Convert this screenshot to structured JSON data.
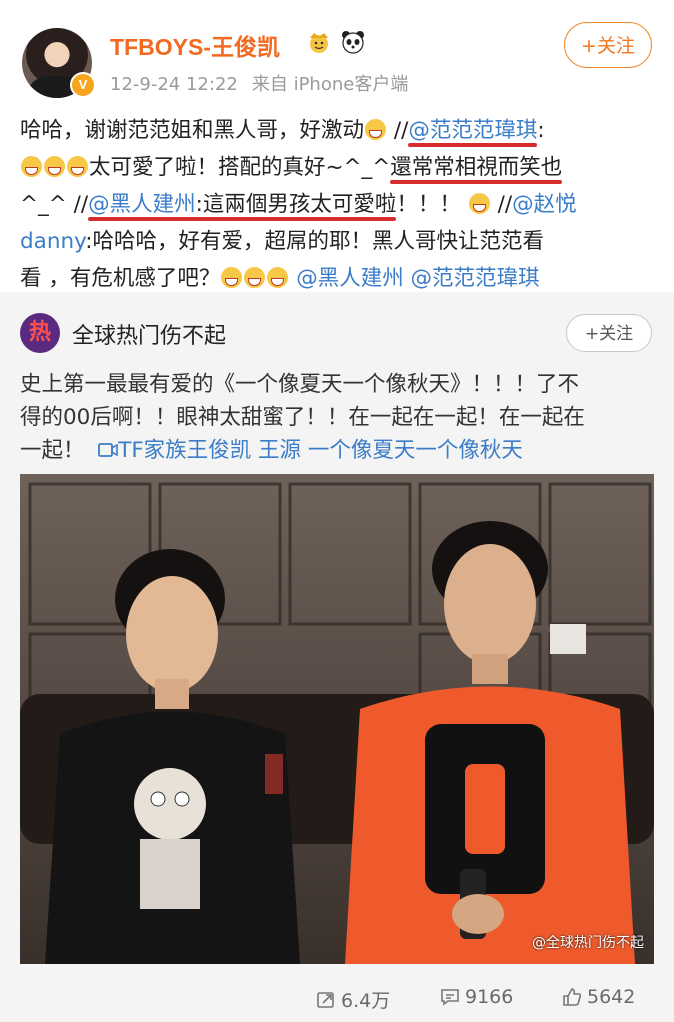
{
  "header": {
    "username": "TFBOYS-王俊凯",
    "timestamp": "12-9-24 12:22",
    "source": "来自 iPhone客户端",
    "follow_label": "+关注",
    "badge": "V"
  },
  "post": {
    "l1_a": "哈哈，谢谢范范姐和黑人哥，好激动",
    "l1_b": "//",
    "l1_mention": "@范范范瑋琪",
    "l1_colon": ":",
    "l2_a": "太可愛了啦！搭配的真好~^_^",
    "l2_b": "還常常相視而笑也",
    "l3_a": "^_^ //",
    "l3_mention": "@黑人建州",
    "l3_b": ":這兩個男孩太可愛啦",
    "l3_c": "！！！",
    "l3_d": "//",
    "l3_mention2": "@赵悦",
    "l4_mention": "danny",
    "l4_b": ":哈哈哈，好有爱，超屌的耶！黑人哥快让范范看",
    "l5_a": "看 ，有危机感了吧？",
    "l5_mention1": "@黑人建州",
    "l5_mention2": "@范范范瑋琪"
  },
  "repost": {
    "avatar_char": "热",
    "name": "全球热门伤不起",
    "follow_label": "+关注",
    "line1": "史上第一最最有爱的《一个像夏天一个像秋天》！！！了不",
    "line2": "得的00后啊！！眼神太甜蜜了！！在一起在一起！在一起在",
    "line3_a": "一起！",
    "line3_link": "TF家族王俊凯 王源 一个像夏天一个像秋天",
    "watermark": "@全球热门伤不起"
  },
  "stats": {
    "reposts": "6.4万",
    "comments": "9166",
    "likes": "5642"
  },
  "colors": {
    "username": "#f26a21",
    "mention": "#3b7dc8",
    "underline": "#d62c2c",
    "repost_bg": "#f4f4f4"
  }
}
